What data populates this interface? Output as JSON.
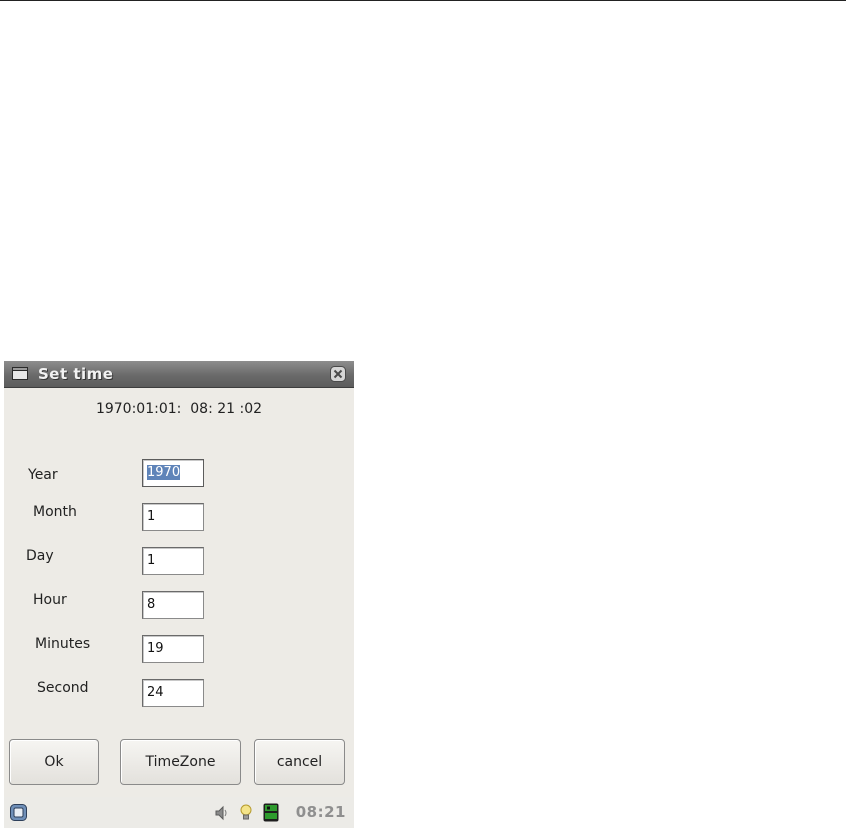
{
  "window": {
    "title": "Set time",
    "current_datetime": "1970:01:01:  08: 21 :02"
  },
  "fields": [
    {
      "label": "Year",
      "value": "1970",
      "selected": true
    },
    {
      "label": "Month",
      "value": "1",
      "selected": false
    },
    {
      "label": "Day",
      "value": "1",
      "selected": false
    },
    {
      "label": "Hour",
      "value": "8",
      "selected": false
    },
    {
      "label": "Minutes",
      "value": "19",
      "selected": false
    },
    {
      "label": "Second",
      "value": "24",
      "selected": false
    }
  ],
  "buttons": {
    "ok": "Ok",
    "timezone": "TimeZone",
    "cancel": "cancel"
  },
  "taskbar": {
    "clock": "08:21",
    "icons": [
      "menu-icon",
      "speaker-icon",
      "lightbulb-icon",
      "battery-icon"
    ]
  },
  "colors": {
    "titlebar": "#6f6f6f",
    "window_bg": "#edebe6",
    "selection": "#5f84b9",
    "battery_green": "#2e9b2e"
  }
}
